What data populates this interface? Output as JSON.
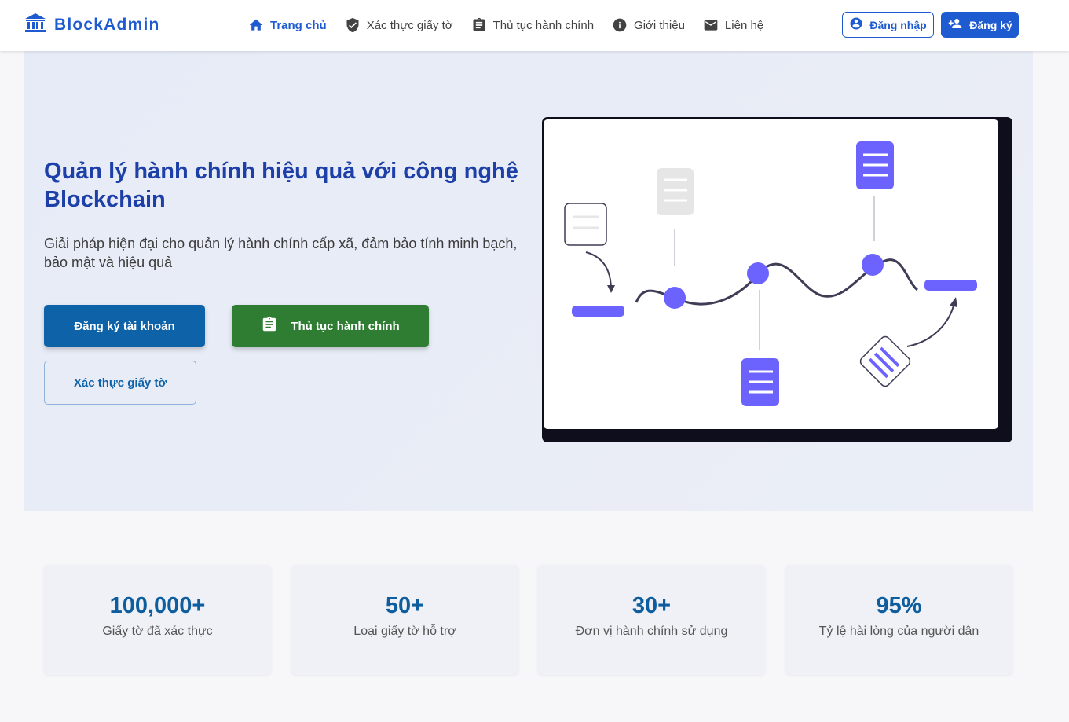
{
  "header": {
    "brand": "BlockAdmin",
    "nav": [
      {
        "label": "Trang chủ",
        "icon": "home-icon",
        "active": true
      },
      {
        "label": "Xác thực giấy tờ",
        "icon": "shield-check-icon",
        "active": false
      },
      {
        "label": "Thủ tục hành chính",
        "icon": "clipboard-icon",
        "active": false
      },
      {
        "label": "Giới thiệu",
        "icon": "info-icon",
        "active": false
      },
      {
        "label": "Liên hệ",
        "icon": "mail-icon",
        "active": false
      }
    ],
    "login_label": "Đăng nhập",
    "signup_label": "Đăng ký"
  },
  "hero": {
    "title": "Quản lý hành chính hiệu quả với công nghệ Blockchain",
    "subtitle": "Giải pháp hiện đại cho quản lý hành chính cấp xã, đảm bảo tính minh bạch, bảo mật và hiệu quả",
    "register_label": "Đăng ký tài khoản",
    "procedures_label": "Thủ tục hành chính",
    "verify_label": "Xác thực giấy tờ"
  },
  "stats": [
    {
      "value": "100,000+",
      "label": "Giấy tờ đã xác thực"
    },
    {
      "value": "50+",
      "label": "Loại giấy tờ hỗ trợ"
    },
    {
      "value": "30+",
      "label": "Đơn vị hành chính sử dụng"
    },
    {
      "value": "95%",
      "label": "Tỷ lệ hài lòng của người dân"
    }
  ],
  "colors": {
    "brand": "#1e5bd1",
    "primary": "#0e62a8",
    "success": "#2e7d32",
    "accent": "#6c63ff"
  }
}
